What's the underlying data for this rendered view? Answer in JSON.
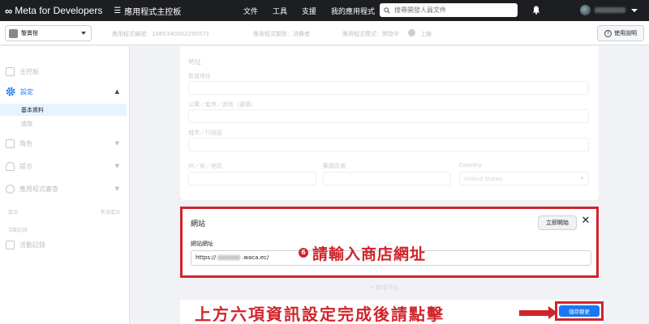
{
  "topbar": {
    "brand": "Meta for Developers",
    "dashboard": "應用程式主控板",
    "nav": [
      "文件",
      "工具",
      "支援",
      "我的應用程式"
    ],
    "search_placeholder": "搜尋開發人員文件"
  },
  "subbar": {
    "app_name": "蟹賣橙",
    "app_id": "應用程式編號：1085340002290571",
    "app_type": "應用程式類型：消費者",
    "app_mode": "應用程式模式：開發中",
    "live": "上線",
    "help": "使用說明"
  },
  "sidebar": {
    "items": [
      {
        "label": "主控板"
      },
      {
        "label": "設定"
      },
      {
        "label": "角色"
      },
      {
        "label": "提示"
      },
      {
        "label": "應用程式審查"
      }
    ],
    "settings_sub": [
      "基本資料",
      "進階"
    ],
    "products_label": "產品",
    "add_product": "新增產品",
    "activity_label": "活動記錄",
    "activity_item": "活動記錄"
  },
  "address_form": {
    "section": "地址",
    "street": "街道地址",
    "apt": "公寓／套房／其他（選填）",
    "city": "城市／行政區",
    "state": "州／省／地區",
    "zip": "郵遞區號",
    "country": "Country",
    "country_value": "United States"
  },
  "website_card": {
    "title": "網站",
    "quick_start": "立即開始",
    "close": "✕",
    "url_label": "網站網址",
    "url_prefix": "https://",
    "url_suffix": ".waca.ec/"
  },
  "annotations": {
    "step_number": "6",
    "step_text": "請輸入商店網址",
    "bottom_text": "上方六項資訊設定完成後請點擊"
  },
  "add_platform": "+ 新增平台",
  "save_button": "儲存變更",
  "colors": {
    "accent": "#1877f2",
    "annotation_red": "#d0242b",
    "topbar": "#1c1e21"
  }
}
